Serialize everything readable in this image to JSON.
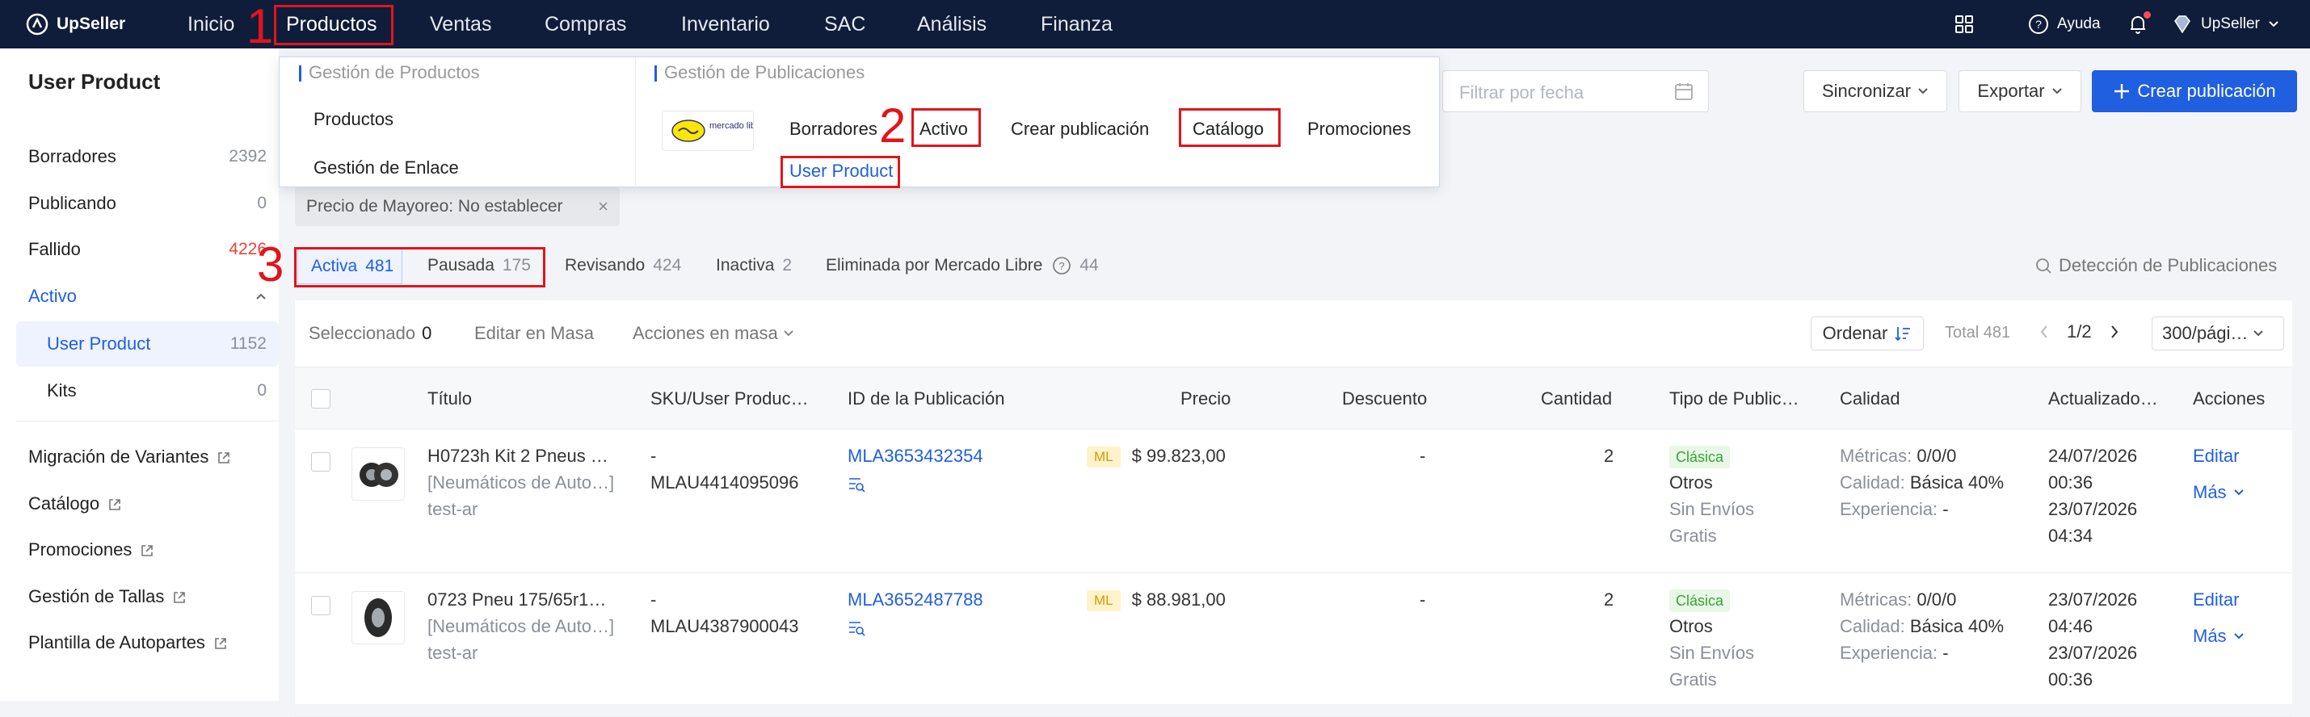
{
  "app": {
    "name": "UpSeller"
  },
  "topnav": {
    "items": [
      "Inicio",
      "Productos",
      "Ventas",
      "Compras",
      "Inventario",
      "SAC",
      "Análisis",
      "Finanza"
    ],
    "help": "Ayuda",
    "account": "UpSeller"
  },
  "sidebar": {
    "title": "User Product",
    "items": [
      {
        "label": "Borradores",
        "count": "2392"
      },
      {
        "label": "Publicando",
        "count": "0"
      },
      {
        "label": "Fallido",
        "count": "4226"
      },
      {
        "label": "Activo",
        "count": ""
      },
      {
        "label": "User Product",
        "count": "1152"
      },
      {
        "label": "Kits",
        "count": "0"
      }
    ],
    "links": [
      "Migración de Variantes",
      "Catálogo",
      "Promociones",
      "Gestión de Tallas",
      "Plantilla de Autopartes"
    ]
  },
  "dropdown": {
    "left_header": "Gestión de Productos",
    "left_items": [
      "Productos",
      "Gestión de Enlace"
    ],
    "right_header": "Gestión de Publicaciones",
    "logo_text": "mercado libre",
    "right_items": [
      "Borradores",
      "Activo",
      "Crear publicación",
      "Catálogo",
      "Promociones"
    ],
    "sub_item": "User Product"
  },
  "toolbar": {
    "filter_placeholder": "Filtrar por fecha",
    "sync": "Sincronizar",
    "export": "Exportar",
    "create": "Crear publicación"
  },
  "filter_chip": "Precio de Mayoreo: No establecer",
  "status_tabs": [
    {
      "label": "Activa",
      "count": "481"
    },
    {
      "label": "Pausada",
      "count": "175"
    },
    {
      "label": "Revisando",
      "count": "424"
    },
    {
      "label": "Inactiva",
      "count": "2"
    },
    {
      "label": "Eliminada por Mercado Libre",
      "count": "44"
    }
  ],
  "detection": "Detección de Publicaciones",
  "table_toolbar": {
    "selected_label": "Seleccionado",
    "selected_count": "0",
    "bulk_edit": "Editar en Masa",
    "bulk_actions": "Acciones en masa",
    "sort": "Ordenar",
    "total": "Total 481",
    "page": "1/2",
    "page_size": "300/pági…"
  },
  "columns": [
    "Título",
    "SKU/User Produc…",
    "ID de la Publicación",
    "Precio",
    "Descuento",
    "Cantidad",
    "Tipo de Public…",
    "Calidad",
    "Actualizado…",
    "Acciones"
  ],
  "rows": [
    {
      "title": "H0723h Kit 2 Pneus …",
      "category": "[Neumáticos de Auto…]",
      "shop": "test-ar",
      "sku": "-",
      "user_product": "MLAU4414095096",
      "id": "MLA3653432354",
      "badge": "ML",
      "price": "$ 99.823,00",
      "discount": "-",
      "qty": "2",
      "type_badge": "Clásica",
      "type_line1": "Otros",
      "type_line2": "Sin Envíos",
      "type_line3": "Gratis",
      "metrics_label": "Métricas:",
      "metrics_value": "0/0/0",
      "quality_label": "Calidad:",
      "quality_value": "Básica 40%",
      "experience_label": "Experiencia:",
      "experience_value": "-",
      "date1": "24/07/2026",
      "time1": "00:36",
      "date2": "23/07/2026",
      "time2": "04:34",
      "edit": "Editar",
      "more": "Más"
    },
    {
      "title": "0723 Pneu 175/65r1…",
      "category": "[Neumáticos de Auto…]",
      "shop": "test-ar",
      "sku": "-",
      "user_product": "MLAU4387900043",
      "id": "MLA3652487788",
      "badge": "ML",
      "price": "$ 88.981,00",
      "discount": "-",
      "qty": "2",
      "type_badge": "Clásica",
      "type_line1": "Otros",
      "type_line2": "Sin Envíos",
      "type_line3": "Gratis",
      "metrics_label": "Métricas:",
      "metrics_value": "0/0/0",
      "quality_label": "Calidad:",
      "quality_value": "Básica 40%",
      "experience_label": "Experiencia:",
      "experience_value": "-",
      "date1": "23/07/2026",
      "time1": "04:46",
      "date2": "23/07/2026",
      "time2": "00:36",
      "edit": "Editar",
      "more": "Más"
    }
  ],
  "annotations": [
    "1",
    "2",
    "3"
  ],
  "colors": {
    "nav_bg": "#0f1d3a",
    "accent": "#1f5fe0",
    "annotation_red": "#e2141c",
    "error": "#e8443a"
  }
}
